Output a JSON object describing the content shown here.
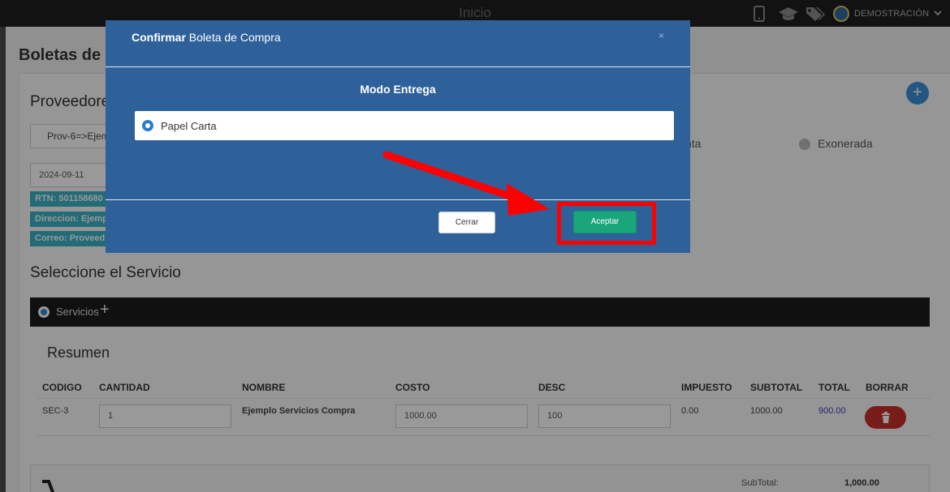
{
  "topbar": {
    "title": "Inicio",
    "user_name": "DEMOSTRACIÓN",
    "icons": [
      "mobile-icon",
      "graduation-cap-icon",
      "tags-icon",
      "user-avatar-icon",
      "chevron-down-icon"
    ]
  },
  "page": {
    "title": "Boletas de co",
    "proveedores_heading": "Proveedore",
    "proveedor_select": "Prov-6=>Ejem",
    "fecha": "2024-09-11",
    "tags": {
      "rtn": "RTN: 501158680",
      "direccion": "Direccion: Ejemp",
      "correo": "Correo: Proveed"
    },
    "radio_partial": "nta",
    "radio_exonerada": "Exonerada",
    "servicio_heading": "Seleccione el Servicio",
    "servicios_label": "Servicios",
    "resumen_heading": "Resumen",
    "table": {
      "headers": [
        "CODIGO",
        "CANTIDAD",
        "NOMBRE",
        "COSTO",
        "DESC",
        "IMPUESTO",
        "SUBTOTAL",
        "TOTAL",
        "BORRAR"
      ],
      "rows": [
        {
          "codigo": "SEC-3",
          "cantidad": "1",
          "nombre": "Ejemplo Servicios Compra",
          "costo": "1000.00",
          "desc": "100",
          "impuesto": "0.00",
          "subtotal": "1000.00",
          "total": "900.00"
        }
      ]
    },
    "footer": {
      "subtotal_label": "SubTotal:",
      "subtotal_value": "1,000.00"
    }
  },
  "modal": {
    "title_bold": "Confirmar",
    "title_rest": " Boleta de Compra",
    "close_symbol": "×",
    "section_title": "Modo Entrega",
    "option_label": "Papel Carta",
    "cerrar_label": "Cerrar",
    "aceptar_label": "Aceptar"
  },
  "colors": {
    "modal_bg": "#2e619a",
    "accept_green": "#1aa67b",
    "annotation_red": "#ff0000",
    "tag_teal": "#3ab2c6"
  }
}
